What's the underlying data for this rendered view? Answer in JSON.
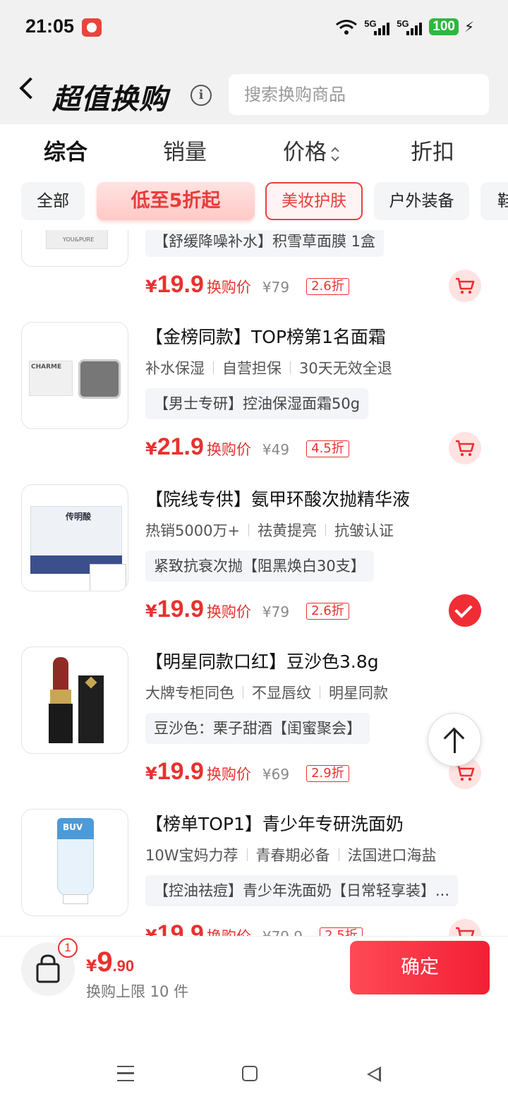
{
  "status_bar": {
    "time": "21:05",
    "net1": "5G",
    "net2": "5G",
    "battery": "100"
  },
  "header": {
    "title": "超值换购",
    "search_placeholder": "搜索换购商品"
  },
  "sort_tabs": [
    {
      "label": "综合",
      "active": true
    },
    {
      "label": "销量",
      "active": false
    },
    {
      "label": "价格",
      "active": false
    },
    {
      "label": "折扣",
      "active": false
    }
  ],
  "chips": [
    {
      "label": "全部"
    },
    {
      "label": "低至5折起"
    },
    {
      "label": "美妆护肤",
      "selected": true
    },
    {
      "label": "户外装备"
    },
    {
      "label": "鞋"
    }
  ],
  "products": [
    {
      "title": "",
      "tags": [],
      "spec": "【舒缓降噪补水】积雪草面膜 1盒",
      "thumb_brand": "YOU&PURE",
      "yen": "¥",
      "price": "19.9",
      "price_label": "换购价",
      "original_price": "¥79",
      "discount": "2.6折",
      "in_cart": false
    },
    {
      "title": "【金榜同款】TOP榜第1名面霜",
      "tags": [
        "补水保湿",
        "自营担保",
        "30天无效全退"
      ],
      "spec": "【男士专研】控油保湿面霜50g",
      "thumb_brand": "CHARME",
      "yen": "¥",
      "price": "21.9",
      "price_label": "换购价",
      "original_price": "¥49",
      "discount": "4.5折",
      "in_cart": false
    },
    {
      "title": "【院线专供】氨甲环酸次抛精华液",
      "tags": [
        "热销5000万+",
        "祛黄提亮",
        "抗皱认证"
      ],
      "spec": "紧致抗衰次抛【阻黑焕白30支】",
      "thumb_brand": "传明酸",
      "yen": "¥",
      "price": "19.9",
      "price_label": "换购价",
      "original_price": "¥79",
      "discount": "2.6折",
      "in_cart": true
    },
    {
      "title": "【明星同款口红】豆沙色3.8g",
      "tags": [
        "大牌专柜同色",
        "不显唇纹",
        "明星同款"
      ],
      "spec": "豆沙色：栗子甜酒【闺蜜聚会】",
      "thumb_brand": "",
      "yen": "¥",
      "price": "19.9",
      "price_label": "换购价",
      "original_price": "¥69",
      "discount": "2.9折",
      "in_cart": false
    },
    {
      "title": "【榜单TOP1】青少年专研洗面奶",
      "tags": [
        "10W宝妈力荐",
        "青春期必备",
        "法国进口海盐"
      ],
      "spec": "【控油祛痘】青少年洗面奶【日常轻享装】...",
      "thumb_brand": "BUV",
      "yen": "¥",
      "price": "19.9",
      "price_label": "换购价",
      "original_price": "¥79.9",
      "discount": "2.5折",
      "in_cart": false
    }
  ],
  "bottom_bar": {
    "badge_count": "1",
    "yen": "¥",
    "total_int": "9",
    "total_dec": ".90",
    "limit_text": "换购上限 10 件",
    "confirm_label": "确定"
  },
  "colors": {
    "accent": "#e8312f",
    "confirm": "#f21f35",
    "battery": "#2db83d"
  }
}
